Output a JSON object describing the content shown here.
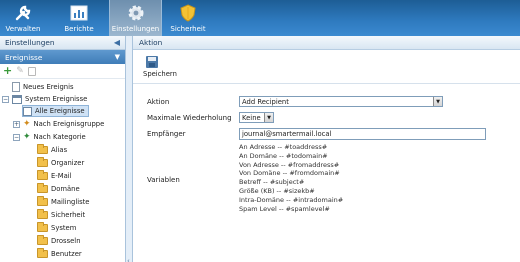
{
  "toolbar": {
    "items": [
      {
        "label": "Verwalten",
        "icon": "wrench-icon"
      },
      {
        "label": "Berichte",
        "icon": "report-icon"
      },
      {
        "label": "Einstellungen",
        "icon": "gear-icon"
      },
      {
        "label": "Sicherheit",
        "icon": "shield-icon"
      }
    ]
  },
  "sidebar": {
    "section_title": "Einstellungen",
    "panel_title": "Ereignisse",
    "tree": {
      "new_event": "Neues Ereignis",
      "system_events": "System Ereignisse",
      "all_events": "Alle Ereignisse",
      "by_group": "Nach Ereignisgruppe",
      "by_category": "Nach Kategorie",
      "categories": [
        "Alias",
        "Organizer",
        "E-Mail",
        "Domäne",
        "Mailingliste",
        "Sicherheit",
        "System",
        "Drosseln",
        "Benutzer"
      ]
    }
  },
  "main": {
    "title": "Aktion",
    "save_label": "Speichern",
    "fields": {
      "action_label": "Aktion",
      "action_value": "Add Recipient",
      "max_repeat_label": "Maximale Wiederholung",
      "max_repeat_value": "Keine",
      "recipient_label": "Empfänger",
      "recipient_value": "journal@smartermail.local",
      "variables_label": "Variablen"
    },
    "variables": [
      "An Adresse -- #toaddress#",
      "An Domäne -- #todomain#",
      "Von Adresse -- #fromaddress#",
      "Von Domäne -- #fromdomain#",
      "Betreff -- #subject#",
      "Größe (KB) -- #sizekb#",
      "Intra-Domäne -- #intradomain#",
      "Spam Level -- #spamlevel#"
    ]
  }
}
